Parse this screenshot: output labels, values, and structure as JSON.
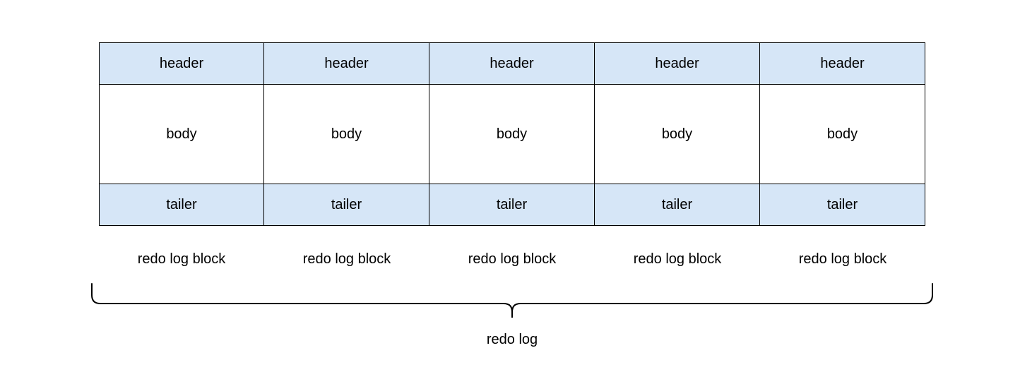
{
  "blocks": [
    {
      "header": "header",
      "body": "body",
      "tailer": "tailer",
      "caption": "redo log block"
    },
    {
      "header": "header",
      "body": "body",
      "tailer": "tailer",
      "caption": "redo log block"
    },
    {
      "header": "header",
      "body": "body",
      "tailer": "tailer",
      "caption": "redo log block"
    },
    {
      "header": "header",
      "body": "body",
      "tailer": "tailer",
      "caption": "redo log block"
    },
    {
      "header": "header",
      "body": "body",
      "tailer": "tailer",
      "caption": "redo log block"
    }
  ],
  "overall_label": "redo log",
  "colors": {
    "header_bg": "#d6e6f7",
    "body_bg": "#ffffff",
    "tailer_bg": "#d6e6f7",
    "border": "#000000"
  }
}
